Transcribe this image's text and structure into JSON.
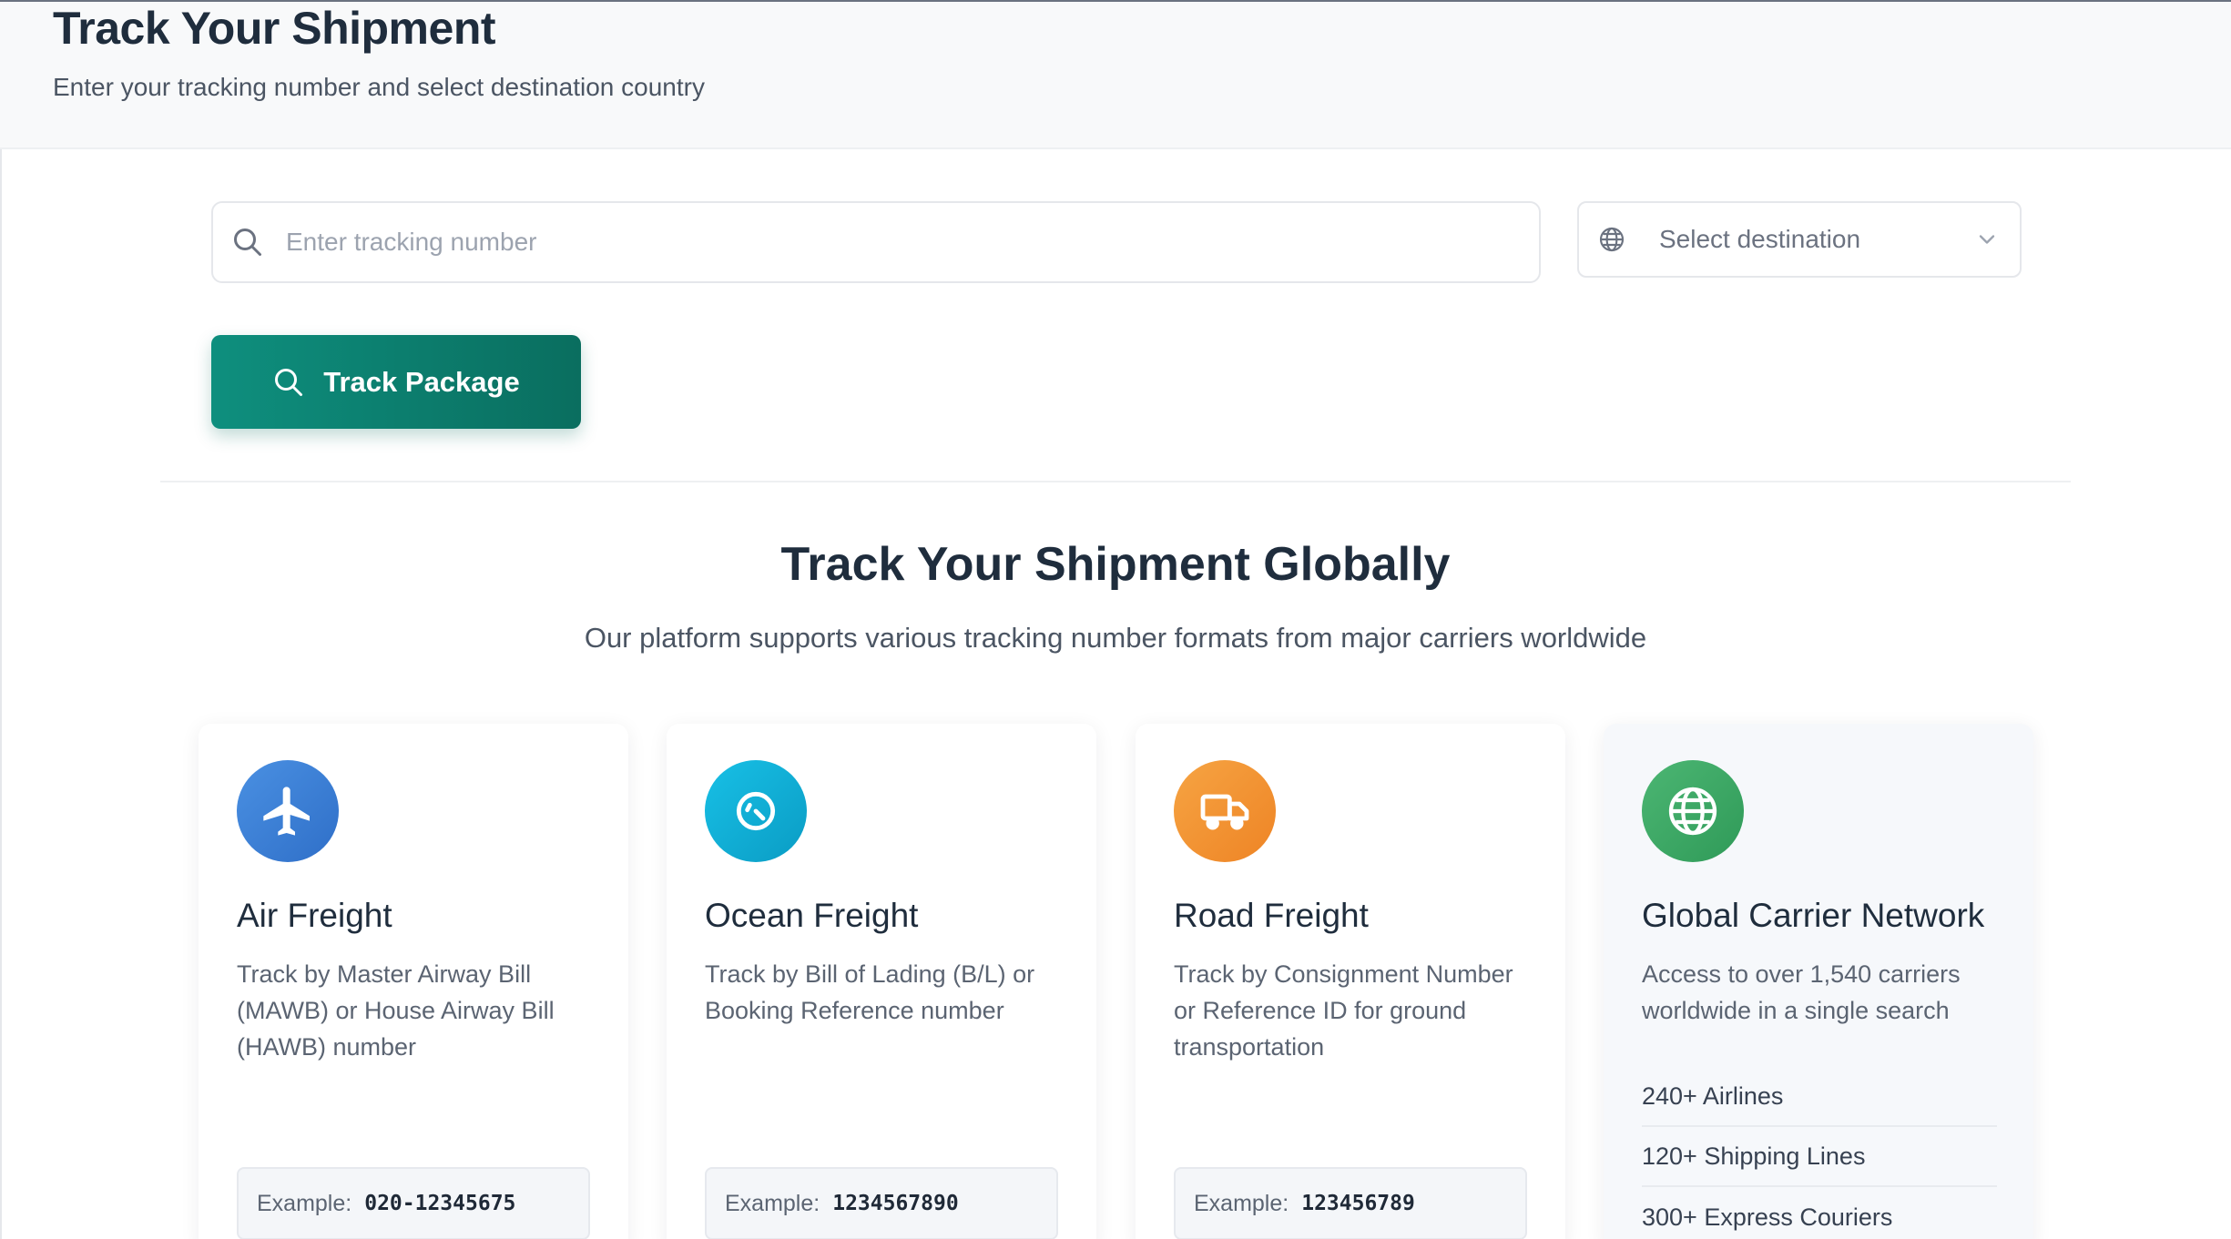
{
  "header": {
    "title": "Track Your Shipment",
    "subtitle": "Enter your tracking number and select destination country"
  },
  "search": {
    "placeholder": "Enter tracking number",
    "icon": "search-icon"
  },
  "destination": {
    "placeholder": "Select destination",
    "icon": "globe-icon"
  },
  "track_button": {
    "label": "Track Package",
    "icon": "search-icon",
    "color": "#0e8f7e"
  },
  "section": {
    "title": "Track Your Shipment Globally",
    "subtitle": "Our platform supports various tracking number formats from major carriers worldwide"
  },
  "cards": [
    {
      "icon": "airplane-icon",
      "color": "#3b82d6",
      "title": "Air Freight",
      "description": "Track by Master Airway Bill (MAWB) or House Airway Bill (HAWB) number",
      "example_label": "Example:",
      "example_value": "020-12345675"
    },
    {
      "icon": "ship-compass-icon",
      "color": "#0fb3d9",
      "title": "Ocean Freight",
      "description": "Track by Bill of Lading (B/L) or Booking Reference number",
      "example_label": "Example:",
      "example_value": "1234567890"
    },
    {
      "icon": "truck-icon",
      "color": "#f39534",
      "title": "Road Freight",
      "description": "Track by Consignment Number or Reference ID for ground transportation",
      "example_label": "Example:",
      "example_value": "123456789"
    },
    {
      "icon": "globe-icon",
      "color": "#3fa866",
      "title": "Global Carrier Network",
      "description": "Access to over 1,540 carriers worldwide in a single search",
      "stats": [
        "240+ Airlines",
        "120+ Shipping Lines",
        "300+ Express Couriers"
      ]
    }
  ]
}
